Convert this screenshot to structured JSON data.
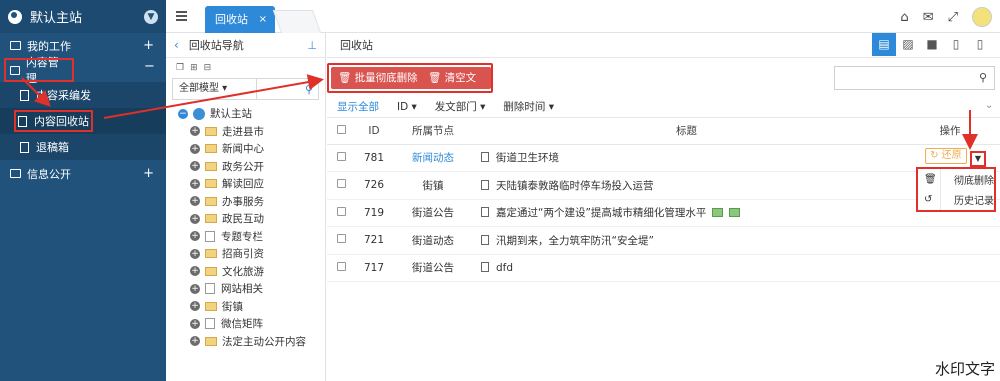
{
  "sidebar": {
    "header": "默认主站",
    "items": [
      {
        "label": "我的工作",
        "expander": "+"
      },
      {
        "label": "内容管理",
        "expander": "−"
      },
      {
        "label": "内容采编发"
      },
      {
        "label": "内容回收站"
      },
      {
        "label": "退稿箱"
      },
      {
        "label": "信息公开",
        "expander": "+"
      }
    ]
  },
  "topbar": {
    "tab_label": "回收站",
    "tab_close": "×"
  },
  "nav": {
    "title": "回收站导航",
    "back": "‹",
    "pin": "⊥",
    "model_select": "全部模型",
    "tree": [
      {
        "label": "默认主站",
        "kind": "root"
      },
      {
        "label": "走进县市",
        "kind": "folder"
      },
      {
        "label": "新闻中心",
        "kind": "folder"
      },
      {
        "label": "政务公开",
        "kind": "folder"
      },
      {
        "label": "解读回应",
        "kind": "folder"
      },
      {
        "label": "办事服务",
        "kind": "folder"
      },
      {
        "label": "政民互动",
        "kind": "folder"
      },
      {
        "label": "专题专栏",
        "kind": "page"
      },
      {
        "label": "招商引资",
        "kind": "folder"
      },
      {
        "label": "文化旅游",
        "kind": "folder"
      },
      {
        "label": "网站相关",
        "kind": "page"
      },
      {
        "label": "街镇",
        "kind": "folder"
      },
      {
        "label": "微信矩阵",
        "kind": "page"
      },
      {
        "label": "法定主动公开内容",
        "kind": "folder"
      }
    ]
  },
  "main": {
    "title": "回收站",
    "buttons": {
      "batch_delete": "🗑 批量彻底删除",
      "clear_all": "🗑 清空文章"
    },
    "filters": {
      "show_all": "显示全部",
      "id": "ID ▾",
      "dept": "发文部门 ▾",
      "del_time": "删除时间 ▾"
    },
    "table": {
      "headers": [
        "ID",
        "所属节点",
        "标题",
        "操作"
      ],
      "rows": [
        {
          "id": "781",
          "node": "新闻动态",
          "title": "街道卫生环境",
          "pics": 0
        },
        {
          "id": "726",
          "node": "街镇",
          "title": "天陆镇泰敦路临时停车场投入运营",
          "pics": 0
        },
        {
          "id": "719",
          "node": "街道公告",
          "title": "嘉定通过“两个建设”提高城市精细化管理水平",
          "pics": 2
        },
        {
          "id": "721",
          "node": "街道动态",
          "title": "汛期到来，全力筑牢防汛“安全堤”",
          "pics": 0
        },
        {
          "id": "717",
          "node": "街道公告",
          "title": "dfd",
          "pics": 0
        }
      ],
      "restore": "↻ 还原"
    },
    "dropdown": {
      "delete": "彻底删除",
      "history": "历史记录"
    }
  },
  "watermark": "水印文字",
  "colors": {
    "sidebar": "#20527c",
    "accent": "#2e8ad8",
    "danger": "#d9534f",
    "highlight": "#e0302a"
  }
}
